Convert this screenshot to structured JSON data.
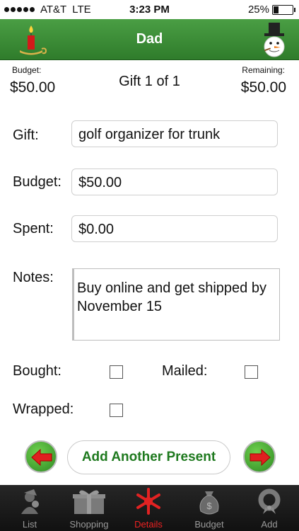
{
  "status": {
    "carrier": "AT&T",
    "network": "LTE",
    "time": "3:23 PM",
    "battery": "25%",
    "battery_level": 0.25
  },
  "nav": {
    "title": "Dad",
    "left_icon": "candle-icon",
    "right_icon": "snowman-icon"
  },
  "summary": {
    "budget_label": "Budget:",
    "budget_value": "$50.00",
    "counter": "Gift 1 of 1",
    "remaining_label": "Remaining:",
    "remaining_value": "$50.00"
  },
  "form": {
    "gift_label": "Gift:",
    "gift_value": "golf organizer for trunk",
    "budget_label": "Budget:",
    "budget_value": "$50.00",
    "spent_label": "Spent:",
    "spent_value": "$0.00",
    "notes_label": "Notes:",
    "notes_value": "Buy online and get shipped by November 15",
    "bought_label": "Bought:",
    "bought_checked": false,
    "mailed_label": "Mailed:",
    "mailed_checked": false,
    "wrapped_label": "Wrapped:",
    "wrapped_checked": false
  },
  "actions": {
    "add_present_label": "Add Another Present",
    "prev_icon": "left-arrow-icon",
    "next_icon": "right-arrow-icon"
  },
  "tabs": [
    {
      "label": "List",
      "icon": "santa-icon",
      "active": false
    },
    {
      "label": "Shopping",
      "icon": "gift-box-icon",
      "active": false
    },
    {
      "label": "Details",
      "icon": "snowflake-icon",
      "active": true
    },
    {
      "label": "Budget",
      "icon": "money-bag-icon",
      "active": false
    },
    {
      "label": "Add",
      "icon": "wreath-icon",
      "active": false
    }
  ],
  "colors": {
    "nav_green": "#3a8f35",
    "accent_red": "#e22222",
    "button_text_green": "#1f7a1f"
  }
}
